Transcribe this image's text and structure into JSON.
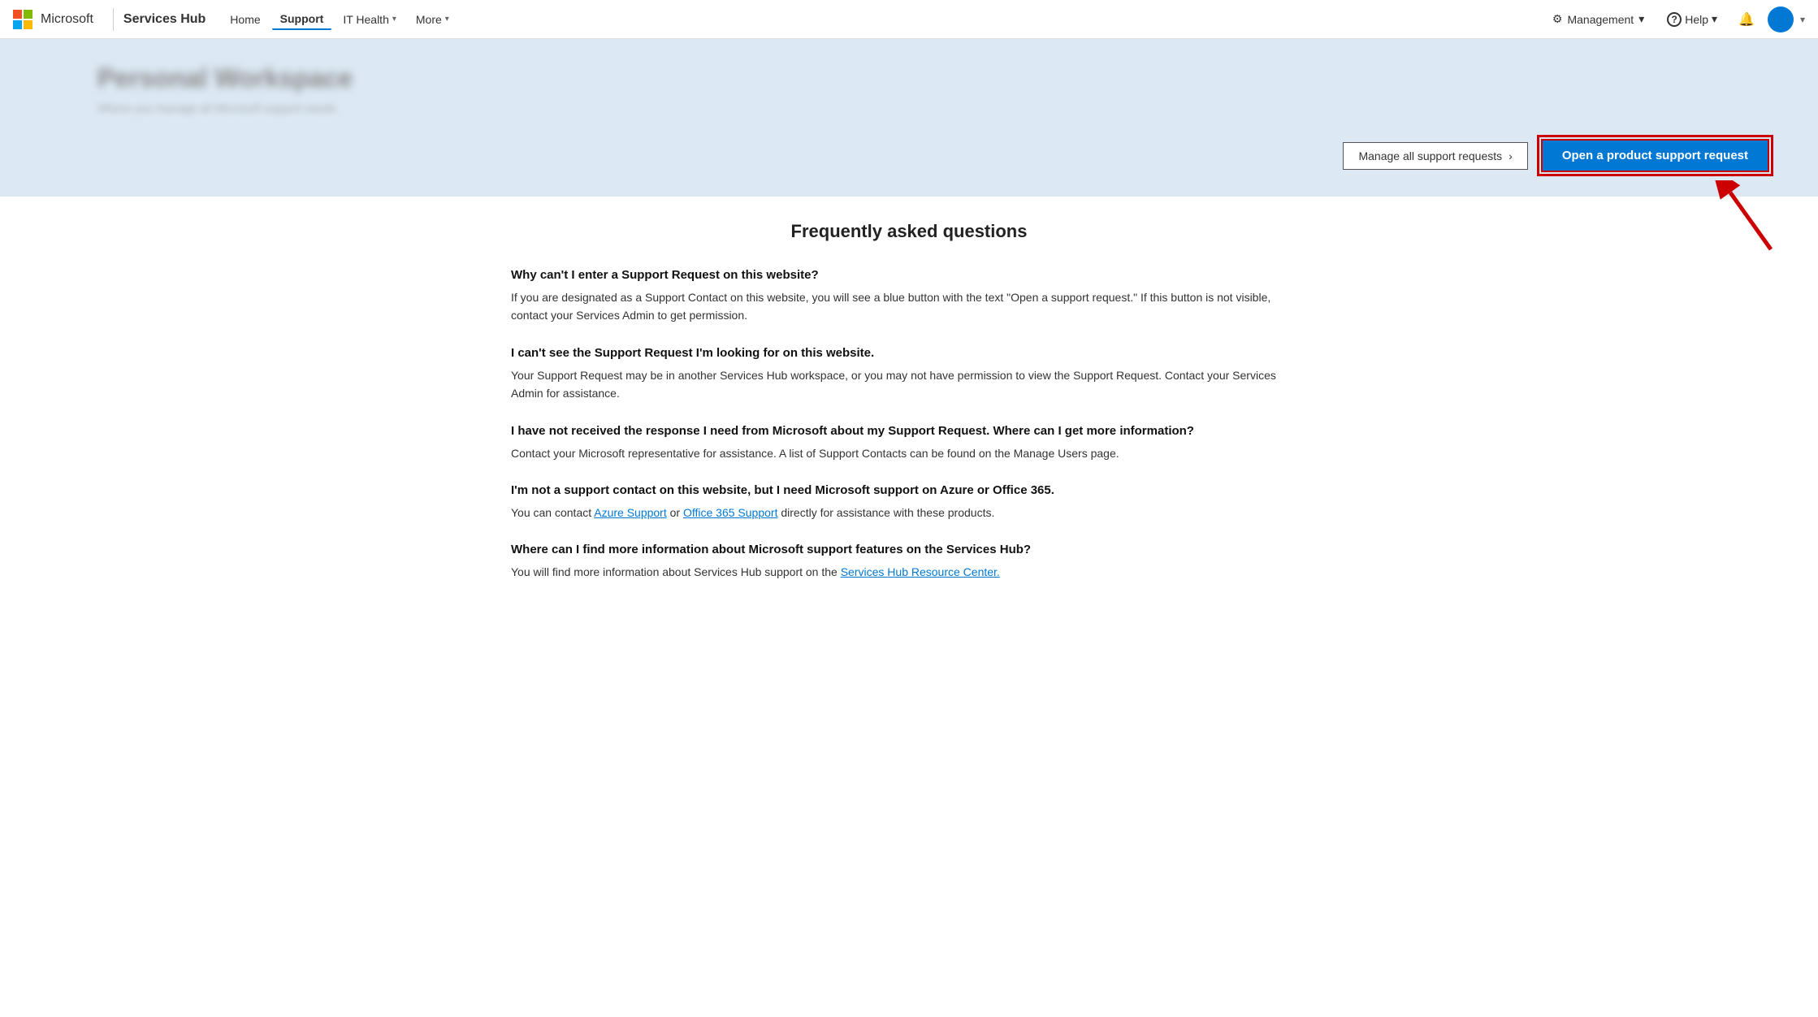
{
  "app": {
    "logo_alt": "Microsoft",
    "brand": "Services Hub"
  },
  "nav": {
    "home_label": "Home",
    "support_label": "Support",
    "it_health_label": "IT Health",
    "more_label": "More",
    "management_label": "Management",
    "help_label": "Help"
  },
  "hero": {
    "title": "Personal Workspace",
    "subtitle": "Where you manage all Microsoft support needs",
    "manage_btn": "Manage all support requests",
    "open_btn": "Open a product support request"
  },
  "faq": {
    "title": "Frequently asked questions",
    "items": [
      {
        "question": "Why can't I enter a Support Request on this website?",
        "answer": "If you are designated as a Support Contact on this website, you will see a blue button with the text \"Open a support request.\" If this button is not visible, contact your Services Admin to get permission."
      },
      {
        "question": "I can't see the Support Request I'm looking for on this website.",
        "answer": "Your Support Request may be in another Services Hub workspace, or you may not have permission to view the Support Request. Contact your Services Admin for assistance."
      },
      {
        "question": "I have not received the response I need from Microsoft about my Support Request. Where can I get more information?",
        "answer": "Contact your Microsoft representative for assistance. A list of Support Contacts can be found on the Manage Users page."
      },
      {
        "question": "I'm not a support contact on this website, but I need Microsoft support on Azure or Office 365.",
        "answer_prefix": "You can contact ",
        "azure_link": "Azure Support",
        "answer_middle": " or ",
        "office_link": "Office 365 Support",
        "answer_suffix": " directly for assistance with these products."
      },
      {
        "question": "Where can I find more information about Microsoft support features on the Services Hub?",
        "answer_prefix": "You will find more information about Services Hub support on the ",
        "resource_link": "Services Hub Resource Center.",
        "answer_suffix": ""
      }
    ]
  }
}
